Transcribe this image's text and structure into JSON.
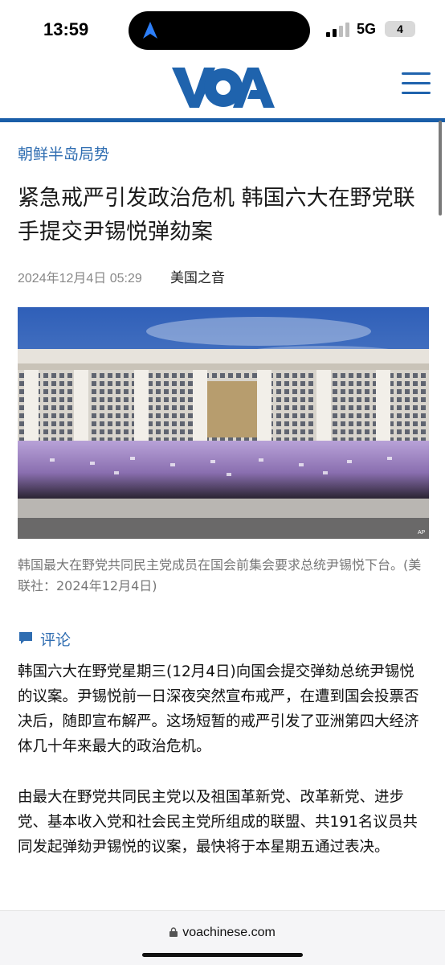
{
  "status_bar": {
    "time": "13:59",
    "network": "5G",
    "battery": "4"
  },
  "header": {
    "logo_text": "VOA",
    "menu_icon": "hamburger-menu-icon",
    "brand_color": "#1f63ad"
  },
  "article": {
    "category": "朝鲜半岛局势",
    "title": "紧急戒严引发政治危机 韩国六大在野党联手提交尹锡悦弹劾案",
    "date": "2024年12月4日 05:29",
    "byline": "美国之音",
    "photo_alt": "韩国最大在野党共同民主党成员在国会前集会要求总统尹锡悦下台。",
    "photo_credit": "AP",
    "caption": "韩国最大在野党共同民主党成员在国会前集会要求总统尹锡悦下台。(美联社：2024年12月4日)",
    "comment_label": "评论",
    "paragraphs": [
      "韩国六大在野党星期三(12月4日)向国会提交弹劾总统尹锡悦的议案。尹锡悦前一日深夜突然宣布戒严，在遭到国会投票否决后，随即宣布解严。这场短暂的戒严引发了亚洲第四大经济体几十年来最大的政治危机。",
      "由最大在野党共同民主党以及祖国革新党、改革新党、进步党、基本收入党和社会民主党所组成的联盟、共191名议员共同发起弹劾尹锡悦的议案，最快将于本星期五通过表决。"
    ]
  },
  "browser": {
    "url": "voachinese.com"
  }
}
